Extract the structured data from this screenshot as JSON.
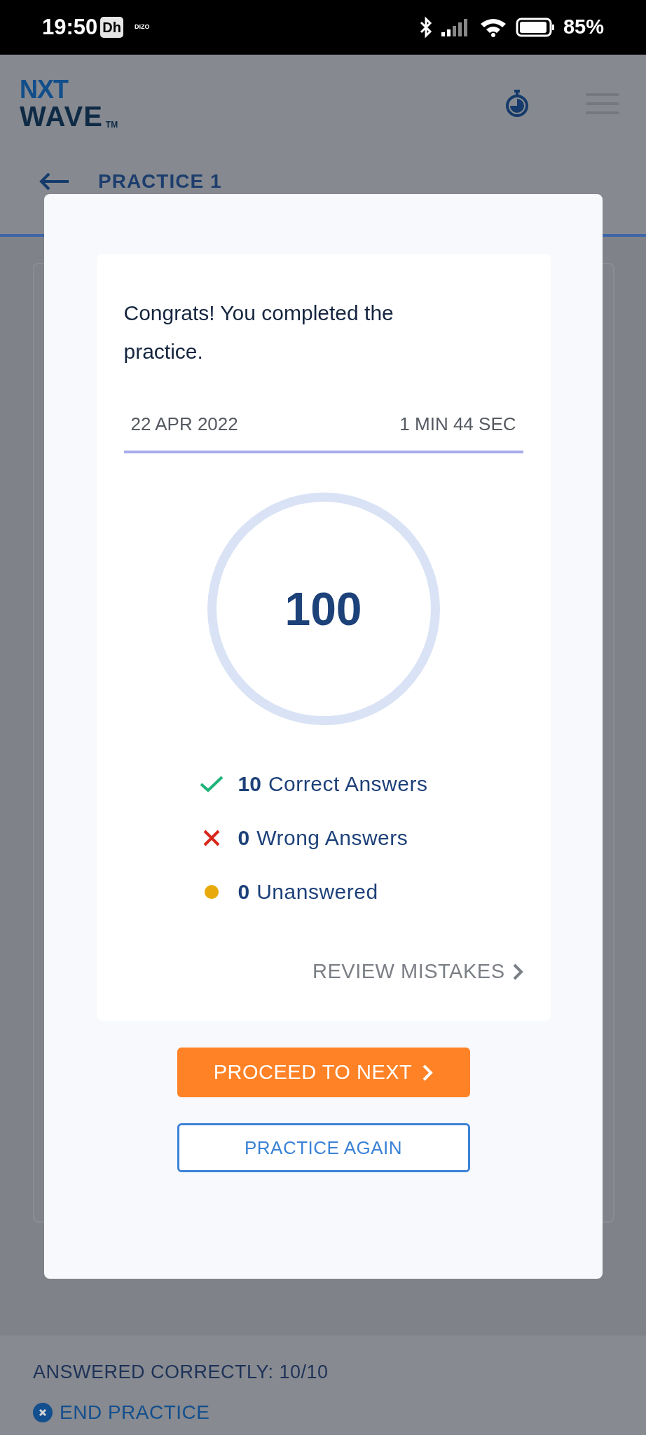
{
  "status_bar": {
    "time": "19:50",
    "app_badge": "Dh",
    "app_label": "DIZO",
    "battery": "85%"
  },
  "header": {
    "logo_top": "NXT",
    "logo_bottom": "WAVE",
    "trademark": "TM"
  },
  "practice_bar": {
    "title": "PRACTICE 1"
  },
  "result_card": {
    "message": "Congrats! You completed the practice.",
    "date": "22 APR 2022",
    "duration": "1 MIN 44 SEC",
    "score": "100",
    "stats": [
      {
        "kind": "correct",
        "count": "10",
        "label": "Correct Answers"
      },
      {
        "kind": "wrong",
        "count": "0",
        "label": "Wrong Answers"
      },
      {
        "kind": "unanswered",
        "count": "0",
        "label": "Unanswered"
      }
    ],
    "review_link": "REVIEW MISTAKES"
  },
  "buttons": [
    {
      "kind": "primary",
      "label": "PROCEED TO NEXT"
    },
    {
      "kind": "outline",
      "label": "PRACTICE AGAIN"
    }
  ],
  "footer": {
    "answered": "ANSWERED CORRECTLY: 10/10",
    "end_practice": "END PRACTICE"
  }
}
